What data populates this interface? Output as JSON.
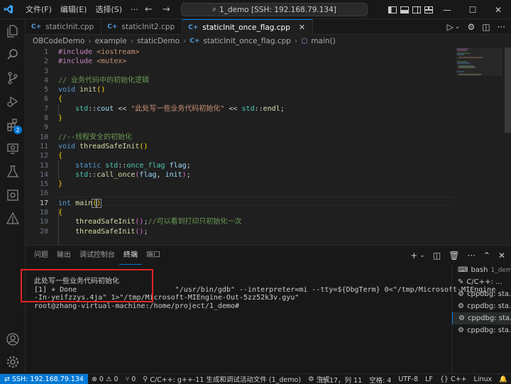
{
  "titlebar": {
    "menus": [
      "文件(F)",
      "编辑(E)",
      "选择(S)"
    ],
    "more": "···",
    "command_center": "1_demo [SSH: 192.168.79.134]"
  },
  "tabs": [
    {
      "label": "staticInit.cpp",
      "active": false
    },
    {
      "label": "staticInit2.cpp",
      "active": false
    },
    {
      "label": "staticInit_once_flag.cpp",
      "active": true
    }
  ],
  "breadcrumb": [
    "OBCodeDemo",
    "example",
    "staticDemo",
    "staticInit_once_flag.cpp",
    "main()"
  ],
  "activity": {
    "badge": "2"
  },
  "editor": {
    "line_numbers": [
      "1",
      "2",
      "3",
      "4",
      "5",
      "6",
      "7",
      "8",
      "9",
      "10",
      "11",
      "12",
      "13",
      "14",
      "15",
      "16",
      "17",
      "18",
      "19",
      "20"
    ],
    "current_line": "17",
    "lines": {
      "l1_a": "#include ",
      "l1_b": "<iostream>",
      "l2_a": "#include ",
      "l2_b": "<mutex>",
      "l4": "// 业务代码中的初始化逻辑",
      "l5_a": "void ",
      "l5_b": "init",
      "l5_c": "()",
      "l6": "{",
      "l7_a": "std",
      "l7_b": "::",
      "l7_c": "cout",
      "l7_d": " << ",
      "l7_e": "\"此处写一些业务代码初始化\"",
      "l7_f": " << ",
      "l7_g": "std",
      "l7_h": "::",
      "l7_i": "endl",
      "l7_j": ";",
      "l8": "}",
      "l10": "//--线程安全的初始化",
      "l11_a": "void ",
      "l11_b": "threadSafeInit",
      "l11_c": "()",
      "l12": "{",
      "l13_a": "static ",
      "l13_b": "std",
      "l13_c": "::",
      "l13_d": "once_flag",
      "l13_e": " flag",
      "l13_f": ";",
      "l14_a": "std",
      "l14_b": "::",
      "l14_c": "call_once",
      "l14_d": "(",
      "l14_e": "flag",
      "l14_f": ", ",
      "l14_g": "init",
      "l14_h": ")",
      "l14_i": ";",
      "l15": "}",
      "l17_a": "int ",
      "l17_b": "main",
      "l17_c": "(",
      "l17_d": ")",
      "l18": "{",
      "l19_a": "threadSafeInit",
      "l19_b": "()",
      "l19_c": ";",
      "l19_d": "//可以看到打印只初始化一次",
      "l20_a": "threadSafeInit",
      "l20_b": "()",
      "l20_c": ";"
    }
  },
  "panel": {
    "tabs": [
      "问题",
      "输出",
      "调试控制台",
      "终端",
      "端口"
    ],
    "active_tab": "终端",
    "terminal_lines": [
      "此处写一些业务代码初始化",
      "[1] + Done                       \"/usr/bin/gdb\" --interpreter=mi --tty=${DbgTerm} 0<\"/tmp/Microsoft-MIEngine",
      "-In-yeifzzys.4ja\" 1>\"/tmp/Microsoft-MIEngine-Out-5zz52k3v.gyu\"",
      "root@zhang-virtual-machine:/home/project/1_demo#"
    ],
    "terminal_list": [
      {
        "name": "bash",
        "sub": "1_demo"
      },
      {
        "name": "C/C++: ...",
        "sub": ""
      },
      {
        "name": "cppdbg: sta...",
        "sub": ""
      },
      {
        "name": "cppdbg: sta...",
        "sub": ""
      },
      {
        "name": "cppdbg: sta...",
        "sub": ""
      },
      {
        "name": "cppdbg: sta...",
        "sub": ""
      }
    ]
  },
  "statusbar": {
    "remote": "SSH: 192.168.79.134",
    "errors": "0",
    "warnings": "0",
    "ports": "0",
    "task": "C/C++: g++-11 生成和调试活动文件 (1_demo)",
    "build": "生成",
    "position": "行 17，列 11",
    "spaces": "空格: 4",
    "encoding": "UTF-8",
    "eol": "LF",
    "language": "C++",
    "os": "Linux"
  },
  "colors": {
    "accent": "#0078d4",
    "highlight_box": "#e02424",
    "background": "#1f1f1f"
  }
}
